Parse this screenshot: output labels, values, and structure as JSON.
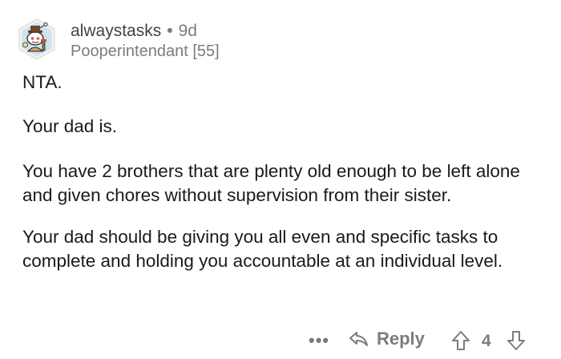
{
  "comment": {
    "author": "alwaystasks",
    "separator": "•",
    "age": "9d",
    "flair": "Pooperintendant [55]",
    "paragraphs": [
      "NTA.",
      "Your dad is.",
      "You have 2 brothers that are plenty old enough to be left alone and given chores without supervision from their sister.",
      "Your dad should be giving you all even and specific tasks to complete and holding you accountable at an individual level."
    ],
    "actions": {
      "more_label": "•••",
      "reply_label": "Reply",
      "score": "4"
    }
  },
  "colors": {
    "text": "#1a1a1b",
    "muted": "#7c7c7c",
    "avatar_bg": "#cfe3ef",
    "avatar_frame": "#f5f5f5"
  },
  "icons": {
    "avatar": "snoo-avatar-icon",
    "reply": "reply-arrow-icon",
    "upvote": "upvote-arrow-icon",
    "downvote": "downvote-arrow-icon"
  }
}
